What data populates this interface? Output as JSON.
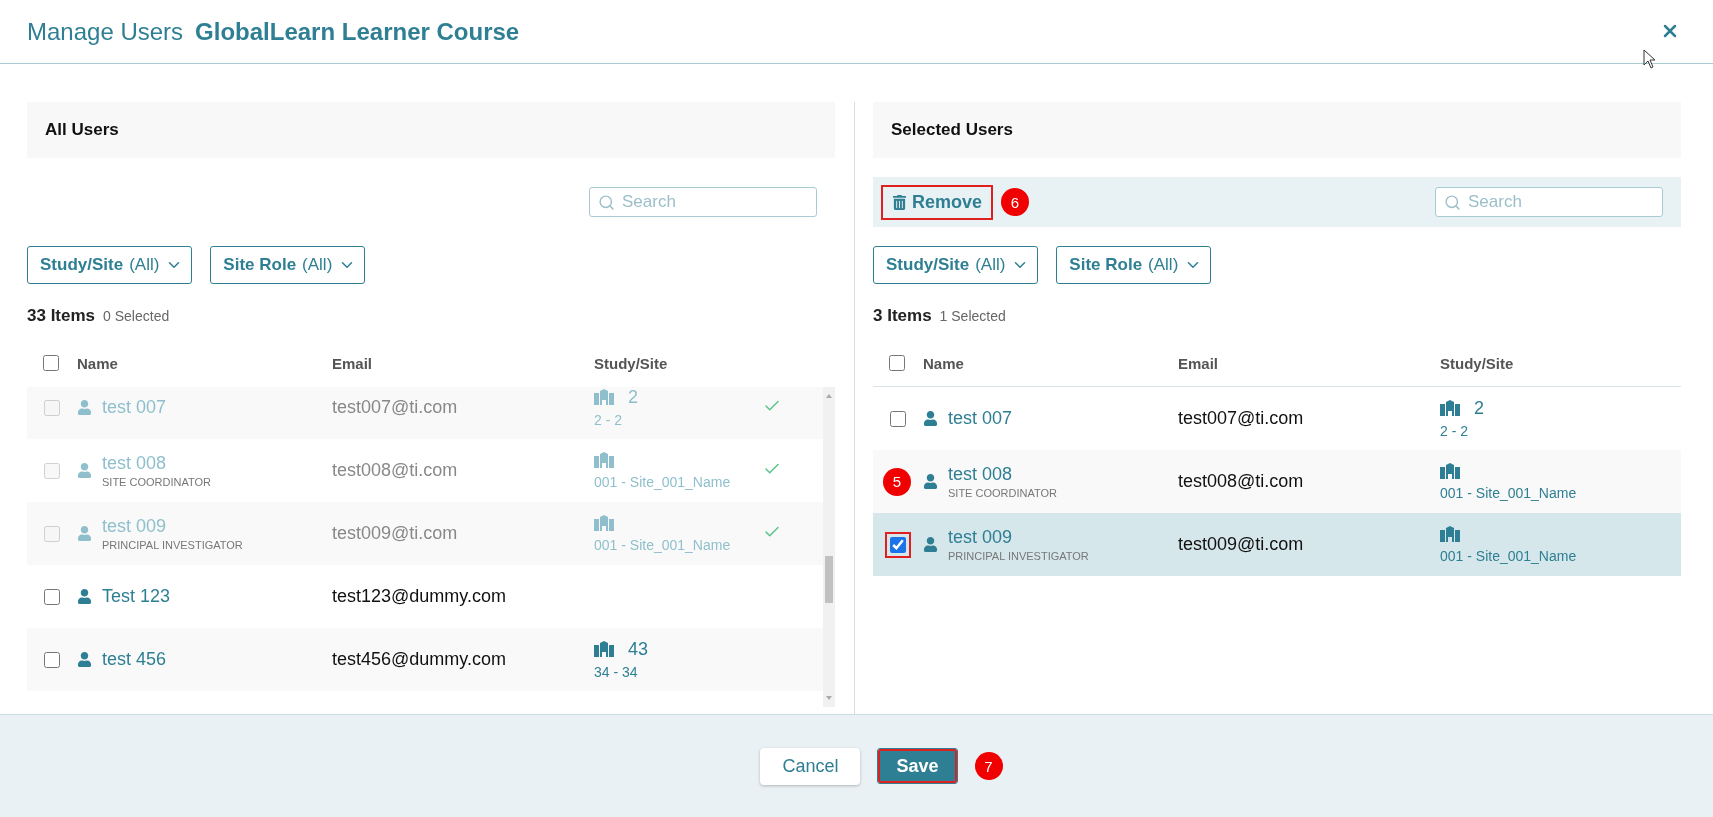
{
  "dialog": {
    "title": "Manage Users",
    "course": "GlobalLearn Learner Course"
  },
  "all_users": {
    "title": "All Users",
    "search": {
      "placeholder": "Search"
    },
    "filters": [
      {
        "label": "Study/Site",
        "value": "(All)"
      },
      {
        "label": "Site Role",
        "value": "(All)"
      }
    ],
    "count": "33 Items",
    "selected_count": "0 Selected",
    "columns": [
      "Name",
      "Email",
      "Study/Site"
    ],
    "header_checked": false,
    "rows": [
      {
        "name": "test 007",
        "email": "test007@ti.com",
        "site_count": "2",
        "site": "2 - 2",
        "checked": false,
        "disabled": true,
        "added": true
      },
      {
        "name": "test 008",
        "role": "SITE COORDINATOR",
        "email": "test008@ti.com",
        "site": "001 - Site_001_Name",
        "checked": false,
        "disabled": true,
        "added": true
      },
      {
        "name": "test 009",
        "role": "PRINCIPAL INVESTIGATOR",
        "email": "test009@ti.com",
        "site": "001 - Site_001_Name",
        "checked": false,
        "disabled": true,
        "added": true
      },
      {
        "name": "Test 123",
        "email": "test123@dummy.com",
        "checked": false,
        "disabled": false,
        "added": false
      },
      {
        "name": "test 456",
        "email": "test456@dummy.com",
        "site_count": "43",
        "site": "34 - 34",
        "checked": false,
        "disabled": false,
        "added": false
      }
    ]
  },
  "selected_users": {
    "title": "Selected Users",
    "remove": {
      "label": "Remove",
      "highlighted": true,
      "callout": "6"
    },
    "search": {
      "placeholder": "Search"
    },
    "filters": [
      {
        "label": "Study/Site",
        "value": "(All)"
      },
      {
        "label": "Site Role",
        "value": "(All)"
      }
    ],
    "count": "3 Items",
    "selected_count": "1 Selected",
    "columns": [
      "Name",
      "Email",
      "Study/Site"
    ],
    "header_checked": false,
    "rows": [
      {
        "name": "test 007",
        "email": "test007@ti.com",
        "site_count": "2",
        "site": "2 - 2",
        "checked": false,
        "highlighted": false
      },
      {
        "name": "test 008",
        "role": "SITE COORDINATOR",
        "email": "test008@ti.com",
        "site": "001 - Site_001_Name",
        "checked": false,
        "callout": "5"
      },
      {
        "name": "test 009",
        "role": "PRINCIPAL INVESTIGATOR",
        "email": "test009@ti.com",
        "site": "001 - Site_001_Name",
        "checked": true,
        "highlighted": true
      }
    ]
  },
  "footer": {
    "cancel": {
      "label": "Cancel"
    },
    "save": {
      "label": "Save",
      "highlighted": true,
      "callout": "7"
    }
  }
}
